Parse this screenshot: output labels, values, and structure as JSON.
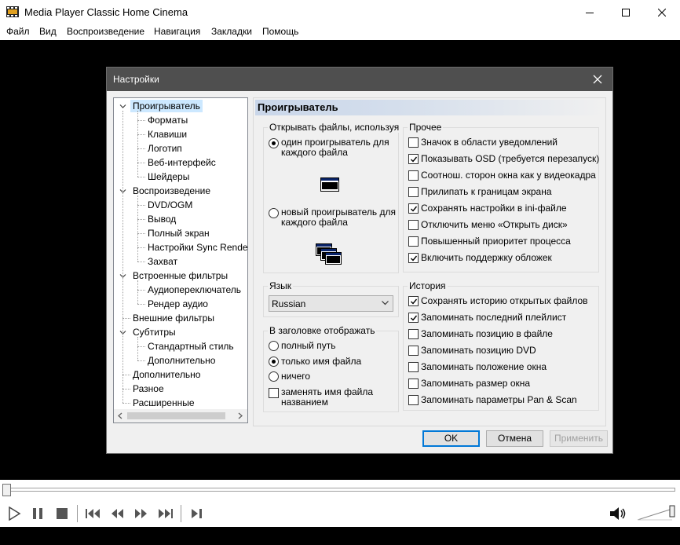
{
  "window": {
    "title": "Media Player Classic Home Cinema"
  },
  "menu": [
    "Файл",
    "Вид",
    "Воспроизведение",
    "Навигация",
    "Закладки",
    "Помощь"
  ],
  "dialog": {
    "title": "Настройки",
    "tree": [
      {
        "label": "Проигрыватель",
        "level": 0,
        "expanded": true,
        "selected": true
      },
      {
        "label": "Форматы",
        "level": 1
      },
      {
        "label": "Клавиши",
        "level": 1
      },
      {
        "label": "Логотип",
        "level": 1
      },
      {
        "label": "Веб-интерфейс",
        "level": 1
      },
      {
        "label": "Шейдеры",
        "level": 1
      },
      {
        "label": "Воспроизведение",
        "level": 0,
        "expanded": true
      },
      {
        "label": "DVD/OGM",
        "level": 1
      },
      {
        "label": "Вывод",
        "level": 1
      },
      {
        "label": "Полный экран",
        "level": 1
      },
      {
        "label": "Настройки Sync Render",
        "level": 1
      },
      {
        "label": "Захват",
        "level": 1
      },
      {
        "label": "Встроенные фильтры",
        "level": 0,
        "expanded": true
      },
      {
        "label": "Аудиопереключатель",
        "level": 1
      },
      {
        "label": "Рендер аудио",
        "level": 1
      },
      {
        "label": "Внешние фильтры",
        "level": 0
      },
      {
        "label": "Субтитры",
        "level": 0,
        "expanded": true
      },
      {
        "label": "Стандартный стиль",
        "level": 1
      },
      {
        "label": "Дополнительно",
        "level": 1
      },
      {
        "label": "Дополнительно",
        "level": 0
      },
      {
        "label": "Разное",
        "level": 0
      },
      {
        "label": "Расширенные",
        "level": 0
      }
    ],
    "pane_title": "Проигрыватель",
    "open_files": {
      "label": "Открывать файлы, используя",
      "opt_single": "один проигрыватель для каждого файла",
      "opt_new": "новый проигрыватель для каждого файла"
    },
    "language": {
      "label": "Язык",
      "value": "Russian"
    },
    "title_display": {
      "label": "В заголовке отображать",
      "opt_full": "полный путь",
      "opt_name": "только имя файла",
      "opt_none": "ничего",
      "replace": "заменять имя файла названием"
    },
    "other": {
      "label": "Прочее",
      "items": [
        {
          "label": "Значок в области уведомлений",
          "checked": false
        },
        {
          "label": "Показывать OSD (требуется перезапуск)",
          "checked": true
        },
        {
          "label": "Соотнош. сторон окна как у видеокадра",
          "checked": false
        },
        {
          "label": "Прилипать к границам экрана",
          "checked": false
        },
        {
          "label": "Сохранять настройки в ini-файле",
          "checked": true
        },
        {
          "label": "Отключить меню «Открыть диск»",
          "checked": false
        },
        {
          "label": "Повышенный приоритет процесса",
          "checked": false
        },
        {
          "label": "Включить поддержку обложек",
          "checked": true
        }
      ]
    },
    "history": {
      "label": "История",
      "items": [
        {
          "label": "Сохранять историю открытых файлов",
          "checked": true
        },
        {
          "label": "Запоминать последний плейлист",
          "checked": true
        },
        {
          "label": "Запоминать позицию в файле",
          "checked": false
        },
        {
          "label": "Запоминать позицию DVD",
          "checked": false
        },
        {
          "label": "Запоминать положение окна",
          "checked": false
        },
        {
          "label": "Запоминать размер окна",
          "checked": false
        },
        {
          "label": "Запоминать параметры Pan & Scan",
          "checked": false
        }
      ]
    },
    "buttons": {
      "ok": "OK",
      "cancel": "Отмена",
      "apply": "Применить"
    }
  }
}
